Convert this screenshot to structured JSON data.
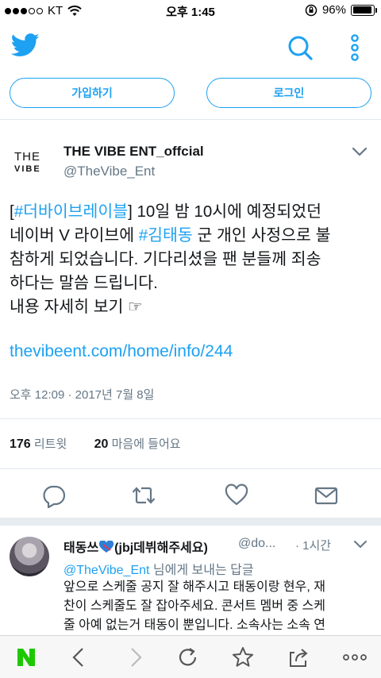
{
  "status_bar": {
    "carrier": "KT",
    "time": "오후 1:45",
    "battery": "96%",
    "signal_bars_filled": 3,
    "signal_bars_total": 5
  },
  "header": {
    "icons": [
      "twitter-bird-icon",
      "search-icon",
      "more-vertical-icon"
    ],
    "accent": "#1da1f2"
  },
  "auth": {
    "signup_label": "가입하기",
    "login_label": "로그인"
  },
  "tweet": {
    "avatar_line1": "THE",
    "avatar_line2": "VIBE",
    "display_name": "THE VIBE ENT_offcial",
    "handle": "@TheVibe_Ent",
    "hashtag1": "#더바이브레이블",
    "line1_pre": "[",
    "line1_post": "] 10일 밤 10시에 예정되었던",
    "line2_pre": "네이버 V 라이브에 ",
    "hashtag2": "#김태동",
    "line2_post": " 군 개인 사정으로 불",
    "line3": "참하게 되었습니다. 기다리셨을 팬 분들께 죄송",
    "line4": "하다는 말씀 드립니다.",
    "line5": "내용 자세히 보기 ☞",
    "link": "thevibeent.com/home/info/244",
    "timestamp": "오후 12:09 · 2017년 7월 8일",
    "retweets_count": "176",
    "retweets_label": "리트윗",
    "likes_count": "20",
    "likes_label": "마음에 들어요"
  },
  "reply": {
    "name_pre": "태동쓰",
    "name_post": "(jbj데뷔해주세요)",
    "handle": "@do...",
    "time": "· 1시간",
    "reply_to_handle": "@TheVibe_Ent",
    "reply_to_label": " 님에게 보내는 답글",
    "line1": "앞으로 스케줄 공지 잘 해주시고 태동이랑 현우, 재",
    "line2": "찬이 스케줄도 잘 잡아주세요. 콘서트 멤버 중 스케",
    "line3": "줄 아예 없는거 태동이 뿐입니다. 소속사는 소속 연"
  },
  "bottom_bar": {
    "icons": [
      "naver-n-icon",
      "back-icon",
      "forward-icon",
      "reload-icon",
      "bookmark-star-icon",
      "share-icon",
      "more-horizontal-icon"
    ]
  }
}
